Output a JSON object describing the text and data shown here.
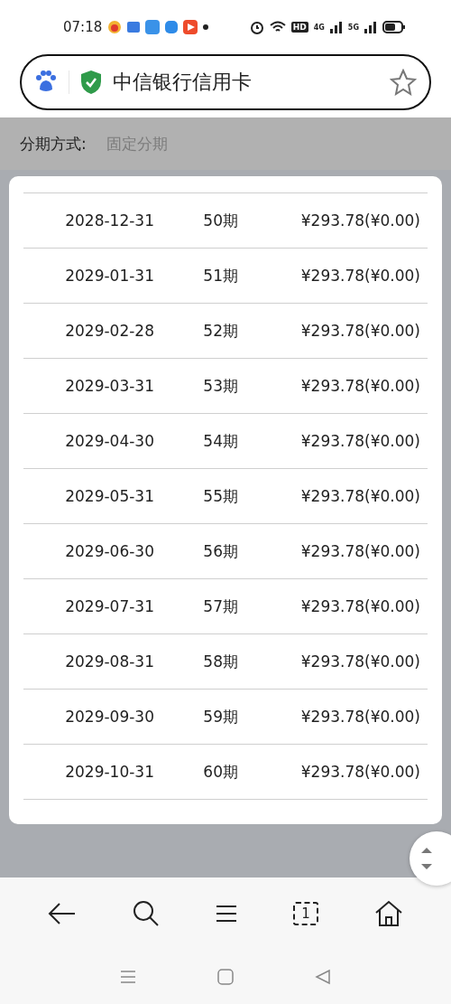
{
  "status_bar": {
    "time": "07:18",
    "hd": "HD",
    "net_1": "4G",
    "net_2": "5G"
  },
  "address_bar": {
    "title": "中信银行信用卡"
  },
  "installment": {
    "label": "分期方式:",
    "value": "固定分期"
  },
  "schedule": [
    {
      "date": "2028-12-31",
      "period": "50期",
      "amount": "¥293.78(¥0.00)"
    },
    {
      "date": "2029-01-31",
      "period": "51期",
      "amount": "¥293.78(¥0.00)"
    },
    {
      "date": "2029-02-28",
      "period": "52期",
      "amount": "¥293.78(¥0.00)"
    },
    {
      "date": "2029-03-31",
      "period": "53期",
      "amount": "¥293.78(¥0.00)"
    },
    {
      "date": "2029-04-30",
      "period": "54期",
      "amount": "¥293.78(¥0.00)"
    },
    {
      "date": "2029-05-31",
      "period": "55期",
      "amount": "¥293.78(¥0.00)"
    },
    {
      "date": "2029-06-30",
      "period": "56期",
      "amount": "¥293.78(¥0.00)"
    },
    {
      "date": "2029-07-31",
      "period": "57期",
      "amount": "¥293.78(¥0.00)"
    },
    {
      "date": "2029-08-31",
      "period": "58期",
      "amount": "¥293.78(¥0.00)"
    },
    {
      "date": "2029-09-30",
      "period": "59期",
      "amount": "¥293.78(¥0.00)"
    },
    {
      "date": "2029-10-31",
      "period": "60期",
      "amount": "¥293.78(¥0.00)"
    }
  ],
  "toolbar": {
    "tab_count": "1"
  }
}
